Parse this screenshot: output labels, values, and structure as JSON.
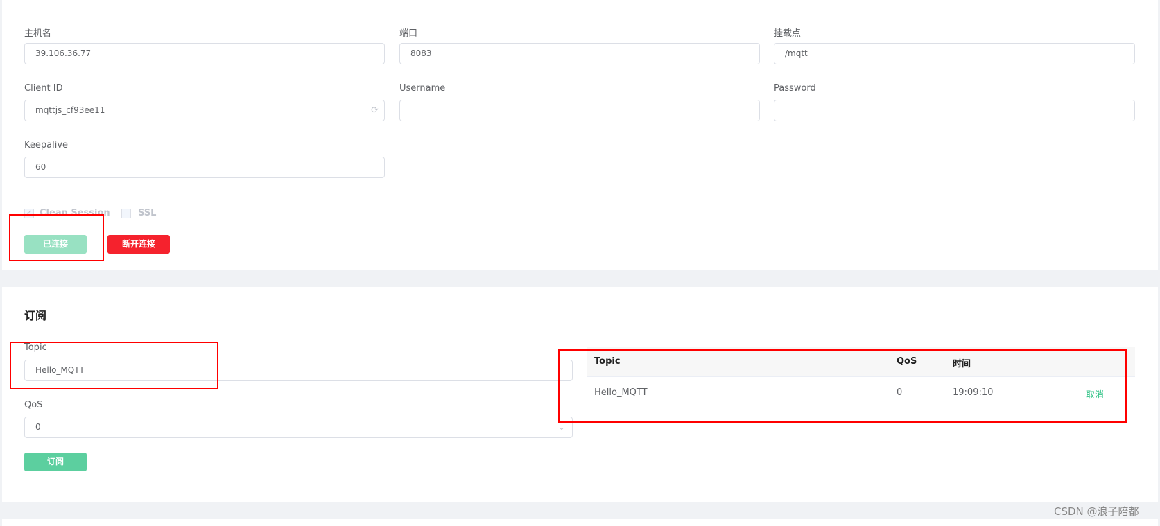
{
  "connection": {
    "host": {
      "label": "主机名",
      "value": "39.106.36.77"
    },
    "port": {
      "label": "端口",
      "value": "8083"
    },
    "mount": {
      "label": "挂载点",
      "value": "/mqtt"
    },
    "client_id": {
      "label": "Client ID",
      "value": "mqttjs_cf93ee11"
    },
    "username": {
      "label": "Username",
      "value": ""
    },
    "password": {
      "label": "Password",
      "value": ""
    },
    "keepalive": {
      "label": "Keepalive",
      "value": "60"
    },
    "clean_session": {
      "label": "Clean Session",
      "checked": true
    },
    "ssl": {
      "label": "SSL",
      "checked": false
    },
    "connected_button": "已连接",
    "disconnect_button": "断开连接"
  },
  "subscribe": {
    "title": "订阅",
    "topic": {
      "label": "Topic",
      "value": "Hello_MQTT"
    },
    "qos": {
      "label": "QoS",
      "value": "0"
    },
    "subscribe_button": "订阅",
    "table": {
      "headers": [
        "Topic",
        "QoS",
        "时间"
      ],
      "rows": [
        {
          "topic": "Hello_MQTT",
          "qos": "0",
          "time": "19:09:10",
          "action": "取消"
        }
      ]
    }
  },
  "watermark": "CSDN @浪子陪都",
  "colors": {
    "accent": "#34c388",
    "accent_disabled": "#98e1c2",
    "danger": "#f5222d",
    "annotation": "#ff0000"
  }
}
